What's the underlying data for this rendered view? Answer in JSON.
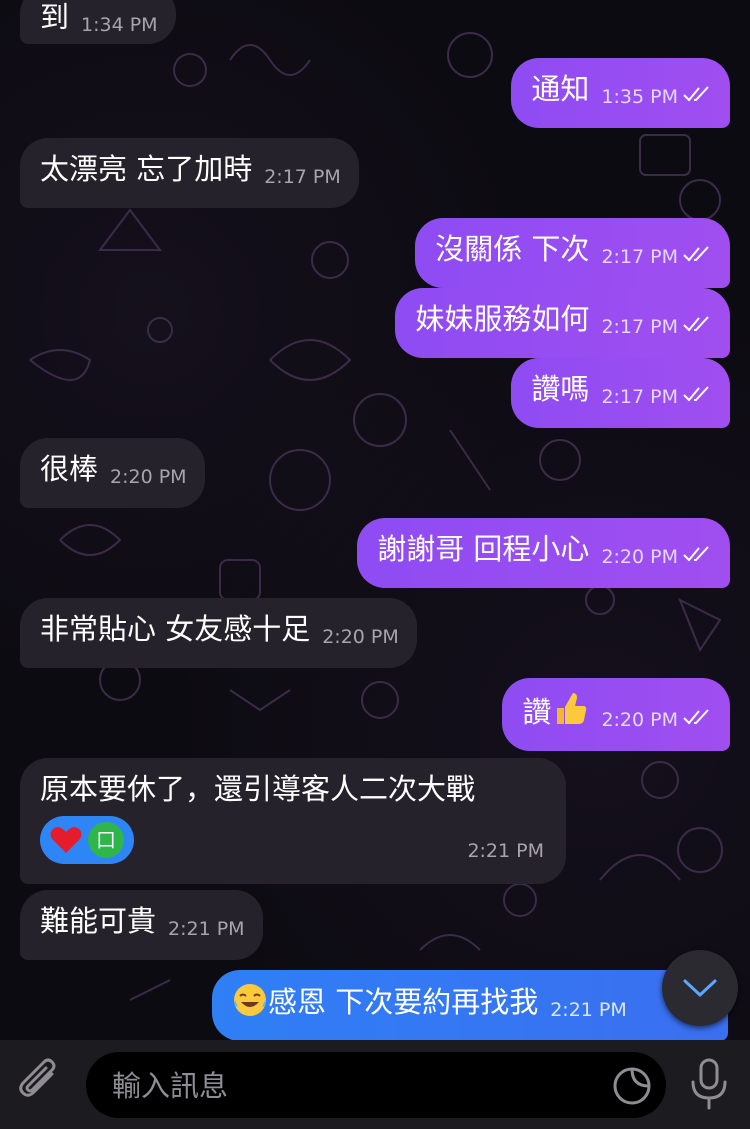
{
  "messages": [
    {
      "text": "到",
      "time": "1:34 PM"
    },
    {
      "text": "通知",
      "time": "1:35 PM"
    },
    {
      "text": "太漂亮 忘了加時",
      "time": "2:17 PM"
    },
    {
      "text": "沒關係 下次",
      "time": "2:17 PM"
    },
    {
      "text": "妹妹服務如何",
      "time": "2:17 PM"
    },
    {
      "text": "讚嗎",
      "time": "2:17 PM"
    },
    {
      "text": "很棒",
      "time": "2:20 PM"
    },
    {
      "text": "謝謝哥 回程小心",
      "time": "2:20 PM"
    },
    {
      "text": "非常貼心 女友感十足",
      "time": "2:20 PM"
    },
    {
      "text": "讚",
      "time": "2:20 PM"
    },
    {
      "text": "原本要休了，還引導客人二次大戰",
      "time": "2:21 PM",
      "reaction_avatar": "口"
    },
    {
      "text": "難能可貴",
      "time": "2:21 PM"
    },
    {
      "text": "感恩 下次要約再找我",
      "time": "2:21 PM"
    }
  ],
  "input": {
    "placeholder": "輸入訊息"
  },
  "colors": {
    "outgoing": "#8e4cf3",
    "outgoing_blue": "#2f7ff5",
    "incoming": "#26222b",
    "background": "#0d0b12"
  }
}
